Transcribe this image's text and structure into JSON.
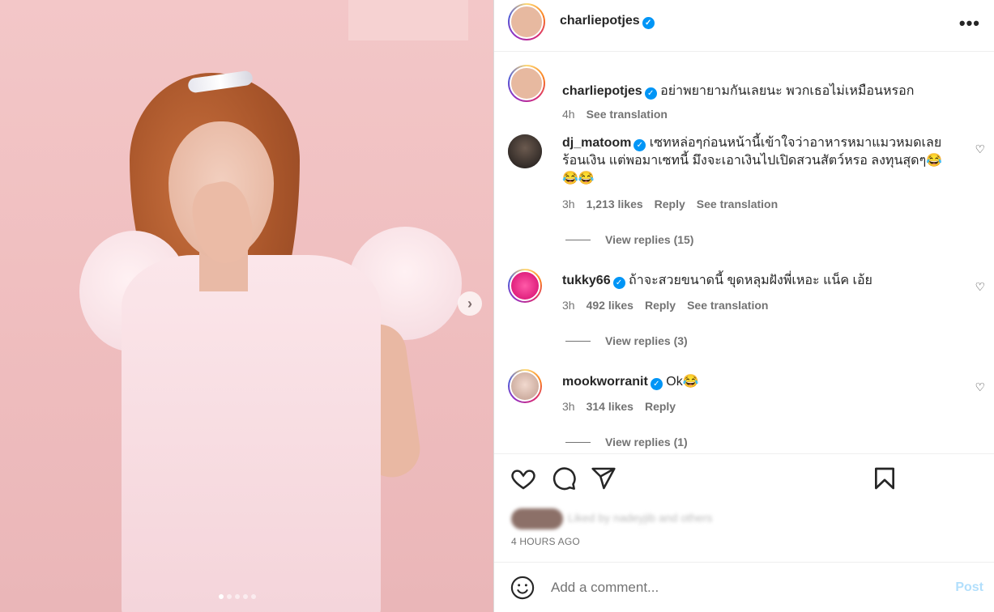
{
  "post": {
    "author": "charliepotjes",
    "caption": {
      "username": "charliepotjes",
      "text": "อย่าพยายามกันเลยนะ พวกเธอไม่เหมือนหรอก",
      "time": "4h",
      "see_translation": "See translation"
    },
    "more_icon": "more-horizontal-icon"
  },
  "comments": [
    {
      "username": "dj_matoom",
      "text": "เซทหล่อๆก่อนหน้านี้เข้าใจว่าอาหารหมาแมวหมดเลยร้อนเงิน แต่พอมาเซทนี้ มึงจะเอาเงินไปเปิดสวนสัตว์หรอ ลงทุนสุดๆ😂😂😂",
      "time": "3h",
      "likes": "1,213 likes",
      "reply": "Reply",
      "see_translation": "See translation",
      "view_replies": "View replies (15)"
    },
    {
      "username": "tukky66",
      "text": "ถ้าจะสวยขนาดนี้ ขุดหลุมฝังพี่เหอะ แน็ค เอ้ย",
      "time": "3h",
      "likes": "492 likes",
      "reply": "Reply",
      "see_translation": "See translation",
      "view_replies": "View replies (3)"
    },
    {
      "username": "mookworranit",
      "text": "Ok😂",
      "time": "3h",
      "likes": "314 likes",
      "reply": "Reply",
      "view_replies": "View replies (1)"
    }
  ],
  "actions": {
    "icons": [
      "heart-icon",
      "comment-icon",
      "share-icon",
      "bookmark-icon"
    ],
    "liked_by": "Liked by nadeyjib and others",
    "time_ago": "4 HOURS AGO"
  },
  "comment_box": {
    "placeholder": "Add a comment...",
    "post_label": "Post",
    "post_color": "#b2dffc"
  },
  "colors": {
    "verified": "#0095f6",
    "muted_text": "#737373"
  }
}
